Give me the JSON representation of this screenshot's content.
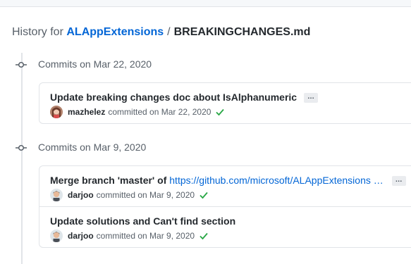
{
  "page": {
    "history_prefix": "History for",
    "repo": "ALAppExtensions",
    "separator": "/",
    "file": "BREAKINGCHANGES.md"
  },
  "groups": [
    {
      "label": "Commits on Mar 22, 2020",
      "commits": [
        {
          "message": "Update breaking changes doc about IsAlphanumeric",
          "ellipsis": "…",
          "author": "mazhelez",
          "committed": "committed on Mar 22, 2020",
          "verified": true
        }
      ]
    },
    {
      "label": "Commits on Mar 9, 2020",
      "commits": [
        {
          "message": "Merge branch 'master' of",
          "link": "https://github.com/microsoft/ALAppExtensions …",
          "ellipsis": "…",
          "author": "darjoo",
          "committed": "committed on Mar 9, 2020",
          "verified": true
        },
        {
          "message": "Update solutions and Can't find section",
          "author": "darjoo",
          "committed": "committed on Mar 9, 2020",
          "verified": true
        }
      ]
    }
  ],
  "icons": {
    "timeline": "commit-node-icon",
    "status": "check-icon"
  },
  "colors": {
    "link": "#0366d6",
    "check": "#28a745",
    "border": "#e1e4e8"
  }
}
